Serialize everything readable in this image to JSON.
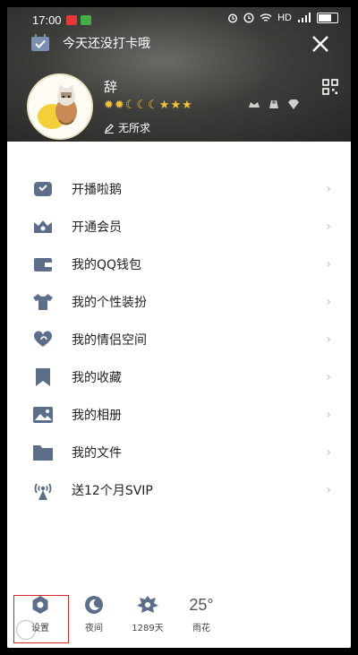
{
  "status_bar": {
    "time": "17:00",
    "net_label": "HD",
    "badge_colors": [
      "#e5383b",
      "#43b047"
    ]
  },
  "header": {
    "checkin_text": "今天还没打卡哦",
    "username": "辞",
    "signature": "无所求",
    "level_icons": [
      "sun",
      "sun",
      "moon",
      "moon",
      "moon",
      "star",
      "star",
      "star"
    ]
  },
  "menu": {
    "items": [
      {
        "label": "开播啦鹅",
        "icon": "live-icon"
      },
      {
        "label": "开通会员",
        "icon": "member-crown-icon"
      },
      {
        "label": "我的QQ钱包",
        "icon": "wallet-icon"
      },
      {
        "label": "我的个性装扮",
        "icon": "tshirt-icon"
      },
      {
        "label": "我的情侣空间",
        "icon": "couple-heart-icon"
      },
      {
        "label": "我的收藏",
        "icon": "bookmark-icon"
      },
      {
        "label": "我的相册",
        "icon": "photo-album-icon"
      },
      {
        "label": "我的文件",
        "icon": "folder-icon"
      },
      {
        "label": "送12个月SVIP",
        "icon": "svip-broadcast-icon"
      }
    ]
  },
  "bottom_bar": {
    "settings_label": "设置",
    "night_label": "夜间",
    "days_label": "1289天",
    "weather_temp": "25°",
    "weather_label": "雨花"
  },
  "colors": {
    "icon_gray": "#5c6e8a",
    "highlight": "#d3262a",
    "level_gold": "#f2c23a"
  }
}
